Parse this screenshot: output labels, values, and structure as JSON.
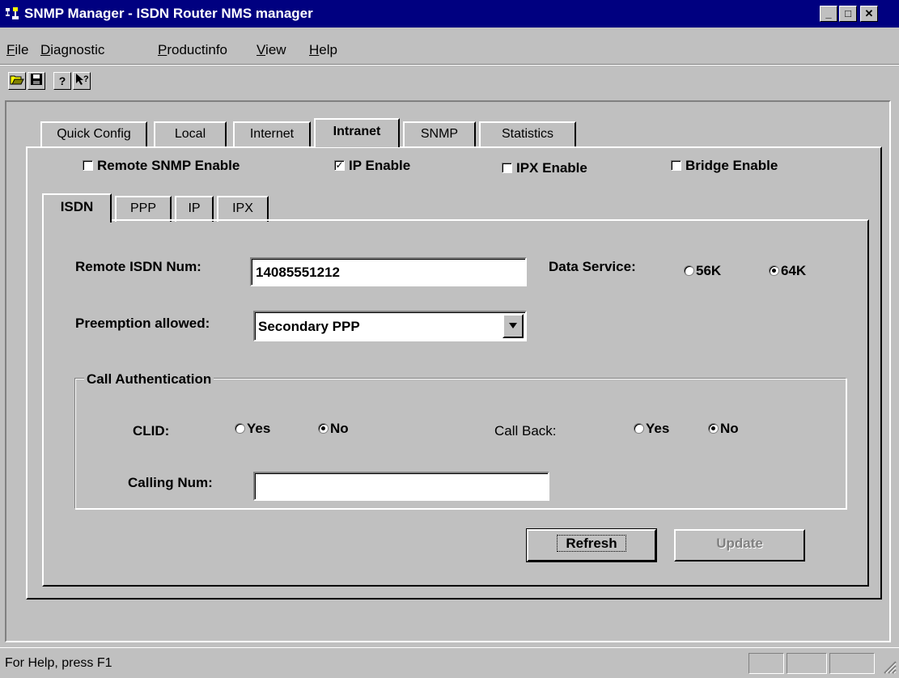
{
  "window": {
    "title": "SNMP Manager - ISDN Router NMS manager",
    "controls": [
      "minimize",
      "maximize",
      "close"
    ]
  },
  "menu": [
    {
      "label": "File",
      "accel": "F",
      "rest": "ile"
    },
    {
      "label": "Diagnostic",
      "accel": "D",
      "rest": "iagnostic"
    },
    {
      "label": "Productinfo",
      "accel": "P",
      "rest": "roductinfo"
    },
    {
      "label": "View",
      "accel": "V",
      "rest": "iew"
    },
    {
      "label": "Help",
      "accel": "H",
      "rest": "elp"
    }
  ],
  "toolbar": {
    "icons": [
      "open-icon",
      "save-icon",
      "help-icon",
      "context-help-icon"
    ]
  },
  "tabs": [
    {
      "label": "Quick Config",
      "selected": false
    },
    {
      "label": "Local",
      "selected": false
    },
    {
      "label": "Internet",
      "selected": false
    },
    {
      "label": "Intranet",
      "selected": true
    },
    {
      "label": "SNMP",
      "selected": false
    },
    {
      "label": "Statistics",
      "selected": false
    }
  ],
  "intranet": {
    "checks": [
      {
        "label": "Remote SNMP Enable",
        "checked": false
      },
      {
        "label": "IP Enable",
        "checked": true
      },
      {
        "label": "IPX Enable",
        "checked": false
      },
      {
        "label": "Bridge Enable",
        "checked": false
      }
    ],
    "subtabs": [
      {
        "label": "ISDN",
        "selected": true
      },
      {
        "label": "PPP",
        "selected": false
      },
      {
        "label": "IP",
        "selected": false
      },
      {
        "label": "IPX",
        "selected": false
      }
    ],
    "isdn": {
      "remote_isdn_label": "Remote ISDN Num:",
      "remote_isdn_value": "14085551212",
      "data_service_label": "Data Service:",
      "data_service_options": [
        {
          "label": "56K",
          "selected": false
        },
        {
          "label": "64K",
          "selected": true
        }
      ],
      "preemption_label": "Preemption allowed:",
      "preemption_value": "Secondary PPP",
      "call_auth": {
        "group_label": "Call Authentication",
        "clid_label": "CLID:",
        "clid_options": [
          {
            "label": "Yes",
            "selected": false
          },
          {
            "label": "No",
            "selected": true
          }
        ],
        "callback_label": "Call Back:",
        "callback_options": [
          {
            "label": "Yes",
            "selected": false
          },
          {
            "label": "No",
            "selected": true
          }
        ],
        "calling_num_label": "Calling Num:",
        "calling_num_value": ""
      },
      "refresh_label": "Refresh",
      "update_label": "Update"
    }
  },
  "status": {
    "text": "For Help, press F1"
  },
  "colors": {
    "titlebar": "#000080",
    "face": "#c0c0c0",
    "disabled_text": "#808080"
  }
}
